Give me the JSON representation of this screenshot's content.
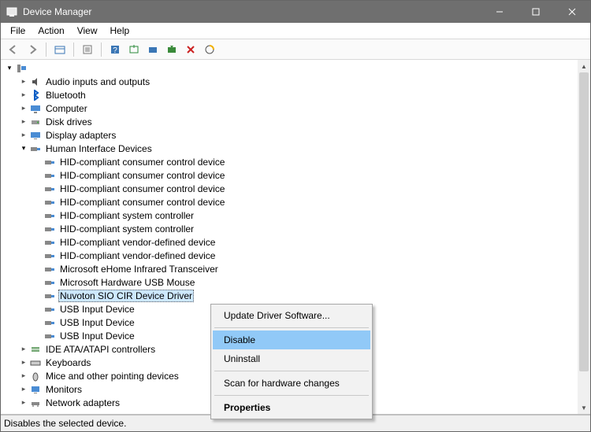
{
  "window": {
    "title": "Device Manager"
  },
  "menu": {
    "file": "File",
    "action": "Action",
    "view": "View",
    "help": "Help"
  },
  "tree": {
    "rootExpanded": true,
    "categories": [
      {
        "label": "Audio inputs and outputs",
        "expanded": false,
        "icon": "audio"
      },
      {
        "label": "Bluetooth",
        "expanded": false,
        "icon": "bluetooth"
      },
      {
        "label": "Computer",
        "expanded": false,
        "icon": "computer"
      },
      {
        "label": "Disk drives",
        "expanded": false,
        "icon": "disk"
      },
      {
        "label": "Display adapters",
        "expanded": false,
        "icon": "display"
      },
      {
        "label": "Human Interface Devices",
        "expanded": true,
        "icon": "hid",
        "children": [
          {
            "label": "HID-compliant consumer control device"
          },
          {
            "label": "HID-compliant consumer control device"
          },
          {
            "label": "HID-compliant consumer control device"
          },
          {
            "label": "HID-compliant consumer control device"
          },
          {
            "label": "HID-compliant system controller"
          },
          {
            "label": "HID-compliant system controller"
          },
          {
            "label": "HID-compliant vendor-defined device"
          },
          {
            "label": "HID-compliant vendor-defined device"
          },
          {
            "label": "Microsoft eHome Infrared Transceiver"
          },
          {
            "label": "Microsoft Hardware USB Mouse"
          },
          {
            "label": "Nuvoton SIO CIR Device Driver",
            "selected": true
          },
          {
            "label": "USB Input Device"
          },
          {
            "label": "USB Input Device"
          },
          {
            "label": "USB Input Device"
          }
        ]
      },
      {
        "label": "IDE ATA/ATAPI controllers",
        "expanded": false,
        "icon": "ide"
      },
      {
        "label": "Keyboards",
        "expanded": false,
        "icon": "keyboard"
      },
      {
        "label": "Mice and other pointing devices",
        "expanded": false,
        "icon": "mouse"
      },
      {
        "label": "Monitors",
        "expanded": false,
        "icon": "monitor"
      },
      {
        "label": "Network adapters",
        "expanded": false,
        "icon": "network"
      }
    ]
  },
  "context": {
    "update": "Update Driver Software...",
    "disable": "Disable",
    "uninstall": "Uninstall",
    "scan": "Scan for hardware changes",
    "properties": "Properties"
  },
  "status": {
    "text": "Disables the selected device."
  }
}
